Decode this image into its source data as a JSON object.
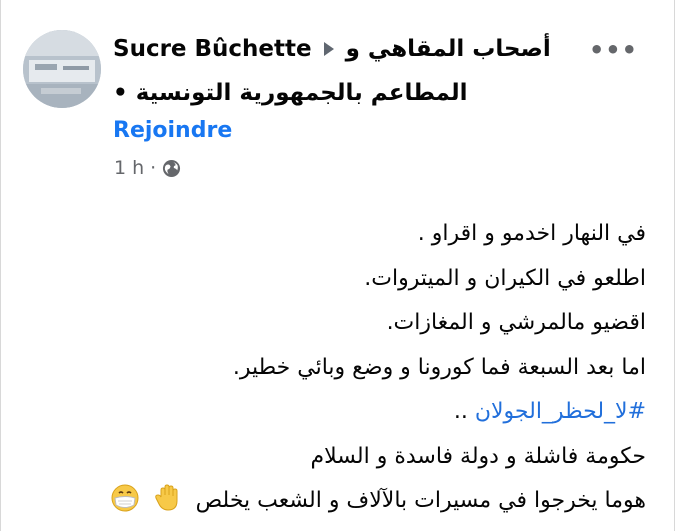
{
  "post": {
    "author": "Sucre Bûchette",
    "group_part1": "أصحاب المقاهي و",
    "group_part2": "المطاعم بالجمهورية التونسية",
    "join_label": "Rejoindre",
    "time": "1 h",
    "more_label": "•••",
    "privacy_icon": "globe-icon",
    "avatar_icon": "avatar-image",
    "lines": [
      "في النهار اخدمو و اقراو .",
      "اطلعو في الكيران و الميتروات.",
      "اقضيو مالمرشي و المغازات.",
      "اما بعد السبعة فما كورونا و وضع وبائي خطير.",
      "..",
      "حكومة فاشلة و دولة فاسدة  و السلام",
      "هوما يخرجوا في مسيرات بالآلاف و الشعب يخلص"
    ],
    "hashtag": "#لا_لحظر_الجولان",
    "emojis": [
      "raised-hand-emoji",
      "mask-face-emoji"
    ]
  },
  "colors": {
    "link": "#1877f2",
    "hashtag": "#216fdb",
    "meta": "#65676b",
    "text": "#050505"
  }
}
